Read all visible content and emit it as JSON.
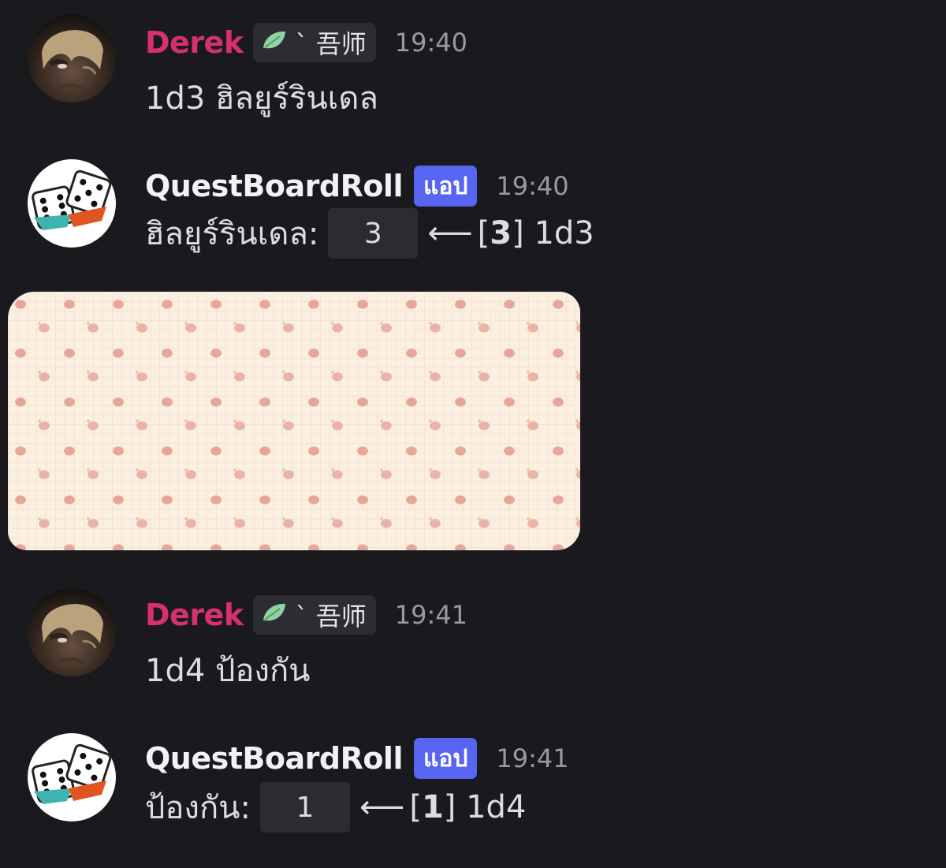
{
  "messages": [
    {
      "author": "Derek",
      "tag_text": "` 吾师",
      "time": "19:40",
      "text": "1d3 ฮิลยูร์รินเดล"
    },
    {
      "author": "QuestBoardRoll",
      "badge": "แอป",
      "time": "19:40",
      "label": "ฮิลยูร์รินเดล:",
      "result": "3",
      "arrow": "⟵",
      "roll_value": "3",
      "dice": "1d3"
    },
    {
      "author": "Derek",
      "tag_text": "` 吾师",
      "time": "19:41",
      "text": "1d4 ป้องกัน"
    },
    {
      "author": "QuestBoardRoll",
      "badge": "แอป",
      "time": "19:41",
      "label": "ป้องกัน:",
      "result": "1",
      "arrow": "⟵",
      "roll_value": "1",
      "dice": "1d4"
    }
  ],
  "colors": {
    "background": "#1a1a1e",
    "derek_name": "#d6306f",
    "app_badge": "#5865f2",
    "tag_bg": "#2c2d33",
    "roll_box": "#2b2c32"
  },
  "icons": {
    "tag_icon": "leaf-icon",
    "bot_avatar": "dice-icon"
  }
}
